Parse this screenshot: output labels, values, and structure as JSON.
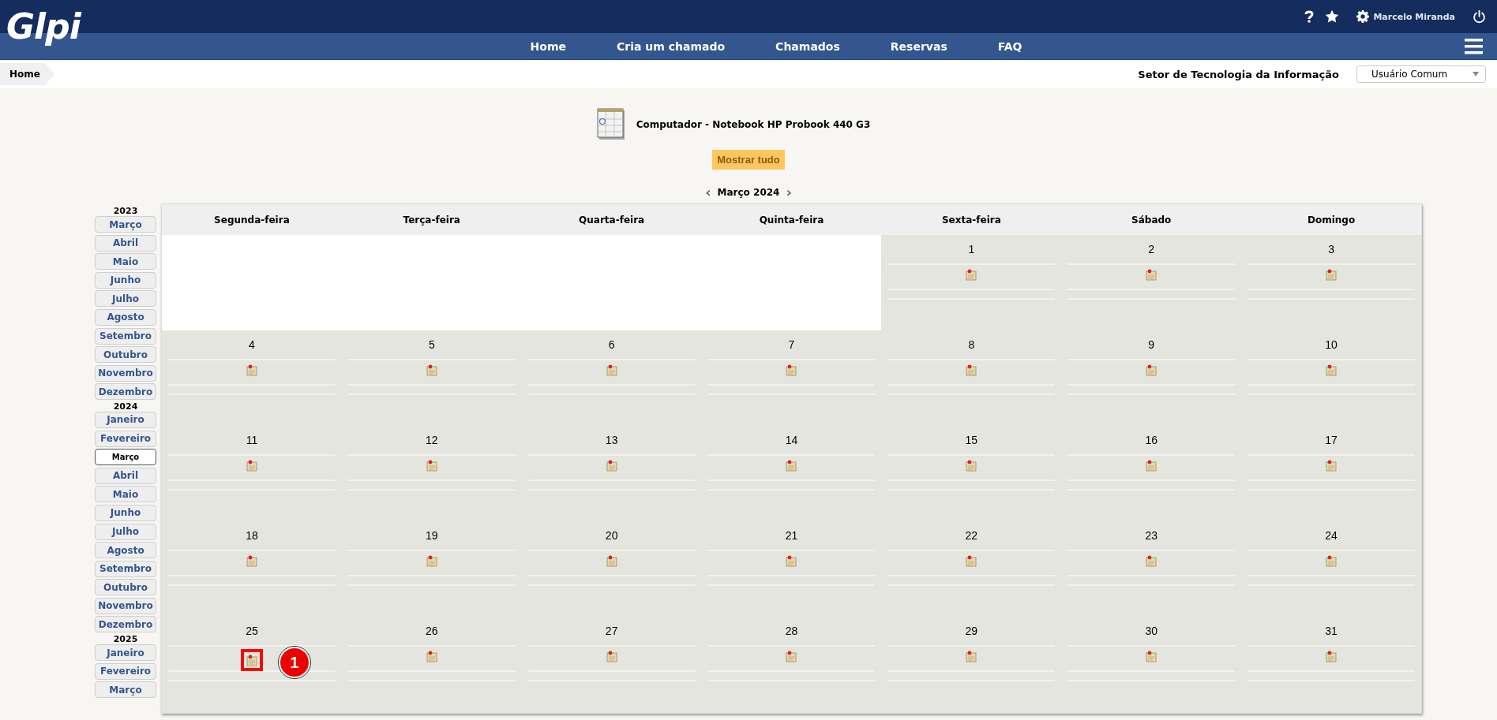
{
  "header": {
    "logo": "Glpi",
    "user_name": "Marcelo Miranda"
  },
  "nav": {
    "items": [
      "Home",
      "Cria um chamado",
      "Chamados",
      "Reservas",
      "FAQ"
    ]
  },
  "breadcrumb": {
    "items": [
      "Home"
    ],
    "entity": "Setor de Tecnologia da Informação",
    "profile": "Usuário Comum"
  },
  "item": {
    "title": "Computador - Notebook HP Probook 440 G3",
    "show_all_button": "Mostrar tudo"
  },
  "month_nav": {
    "prev": "‹",
    "label": "Março 2024",
    "next": "›"
  },
  "sidebar": {
    "years": [
      {
        "year": "2023",
        "months": [
          {
            "label": "Março",
            "selected": false
          },
          {
            "label": "Abril",
            "selected": false
          },
          {
            "label": "Maio",
            "selected": false
          },
          {
            "label": "Junho",
            "selected": false
          },
          {
            "label": "Julho",
            "selected": false
          },
          {
            "label": "Agosto",
            "selected": false
          },
          {
            "label": "Setembro",
            "selected": false
          },
          {
            "label": "Outubro",
            "selected": false
          },
          {
            "label": "Novembro",
            "selected": false
          },
          {
            "label": "Dezembro",
            "selected": false
          }
        ]
      },
      {
        "year": "2024",
        "months": [
          {
            "label": "Janeiro",
            "selected": false
          },
          {
            "label": "Fevereiro",
            "selected": false
          },
          {
            "label": "Março",
            "selected": true
          },
          {
            "label": "Abril",
            "selected": false
          },
          {
            "label": "Maio",
            "selected": false
          },
          {
            "label": "Junho",
            "selected": false
          },
          {
            "label": "Julho",
            "selected": false
          },
          {
            "label": "Agosto",
            "selected": false
          },
          {
            "label": "Setembro",
            "selected": false
          },
          {
            "label": "Outubro",
            "selected": false
          },
          {
            "label": "Novembro",
            "selected": false
          },
          {
            "label": "Dezembro",
            "selected": false
          }
        ]
      },
      {
        "year": "2025",
        "months": [
          {
            "label": "Janeiro",
            "selected": false
          },
          {
            "label": "Fevereiro",
            "selected": false
          },
          {
            "label": "Março",
            "selected": false
          }
        ]
      }
    ]
  },
  "calendar": {
    "weekdays": [
      "Segunda-feira",
      "Terça-feira",
      "Quarta-feira",
      "Quinta-feira",
      "Sexta-feira",
      "Sábado",
      "Domingo"
    ],
    "weeks": [
      [
        {
          "kind": "blank"
        },
        {
          "kind": "blank"
        },
        {
          "kind": "blank"
        },
        {
          "kind": "blank"
        },
        {
          "kind": "day",
          "day": "1",
          "highlighted": false
        },
        {
          "kind": "day",
          "day": "2",
          "highlighted": false
        },
        {
          "kind": "day",
          "day": "3",
          "highlighted": false
        }
      ],
      [
        {
          "kind": "day",
          "day": "4",
          "highlighted": false
        },
        {
          "kind": "day",
          "day": "5",
          "highlighted": false
        },
        {
          "kind": "day",
          "day": "6",
          "highlighted": false
        },
        {
          "kind": "day",
          "day": "7",
          "highlighted": false
        },
        {
          "kind": "day",
          "day": "8",
          "highlighted": false
        },
        {
          "kind": "day",
          "day": "9",
          "highlighted": false
        },
        {
          "kind": "day",
          "day": "10",
          "highlighted": false
        }
      ],
      [
        {
          "kind": "day",
          "day": "11",
          "highlighted": false
        },
        {
          "kind": "day",
          "day": "12",
          "highlighted": false
        },
        {
          "kind": "day",
          "day": "13",
          "highlighted": false
        },
        {
          "kind": "day",
          "day": "14",
          "highlighted": false
        },
        {
          "kind": "day",
          "day": "15",
          "highlighted": false
        },
        {
          "kind": "day",
          "day": "16",
          "highlighted": false
        },
        {
          "kind": "day",
          "day": "17",
          "highlighted": false
        }
      ],
      [
        {
          "kind": "day",
          "day": "18",
          "highlighted": false
        },
        {
          "kind": "day",
          "day": "19",
          "highlighted": false
        },
        {
          "kind": "day",
          "day": "20",
          "highlighted": false
        },
        {
          "kind": "day",
          "day": "21",
          "highlighted": false
        },
        {
          "kind": "day",
          "day": "22",
          "highlighted": false
        },
        {
          "kind": "day",
          "day": "23",
          "highlighted": false
        },
        {
          "kind": "day",
          "day": "24",
          "highlighted": false
        }
      ],
      [
        {
          "kind": "day",
          "day": "25",
          "highlighted": true,
          "callout": "1"
        },
        {
          "kind": "day",
          "day": "26",
          "highlighted": false
        },
        {
          "kind": "day",
          "day": "27",
          "highlighted": false
        },
        {
          "kind": "day",
          "day": "28",
          "highlighted": false
        },
        {
          "kind": "day",
          "day": "29",
          "highlighted": false
        },
        {
          "kind": "day",
          "day": "30",
          "highlighted": false
        },
        {
          "kind": "day",
          "day": "31",
          "highlighted": false
        }
      ]
    ]
  }
}
